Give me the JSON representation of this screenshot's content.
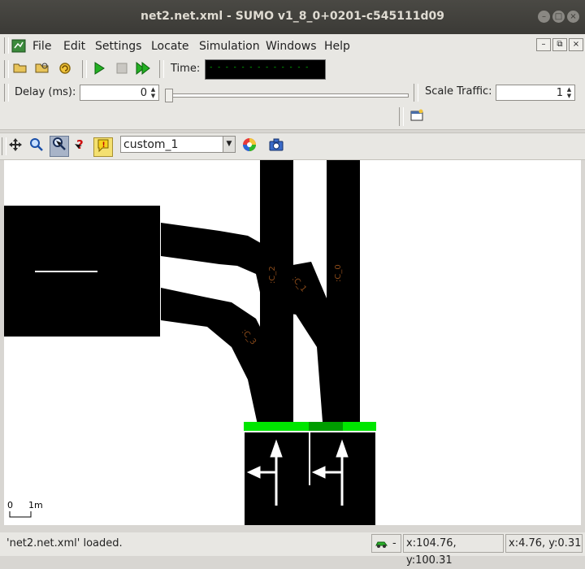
{
  "window": {
    "title": "net2.net.xml - SUMO v1_8_0+0201-c545111d09"
  },
  "menu": {
    "items": [
      "File",
      "Edit",
      "Settings",
      "Locate",
      "Simulation",
      "Windows",
      "Help"
    ]
  },
  "controls": {
    "time_label": "Time:",
    "time_value": "- - - - - - - - - - - - -",
    "delay_label": "Delay (ms):",
    "delay_value": "0",
    "scale_label": "Scale Traffic:",
    "scale_value": "1",
    "scheme_value": "custom_1"
  },
  "canvas": {
    "labels": [
      ":C_2",
      ":C_1",
      ":C_0",
      ":C_3"
    ],
    "scale_zero": "0",
    "scale_unit": "1m"
  },
  "status": {
    "message": "'net2.net.xml' loaded.",
    "vehicle_count": "-",
    "coords_net": "x:104.76, y:100.31",
    "coords_local": "x:4.76, y:0.31"
  },
  "colors": {
    "accent_green": "#00e600",
    "dark_green": "#009c00",
    "junction_label": "#8a4a1a"
  }
}
